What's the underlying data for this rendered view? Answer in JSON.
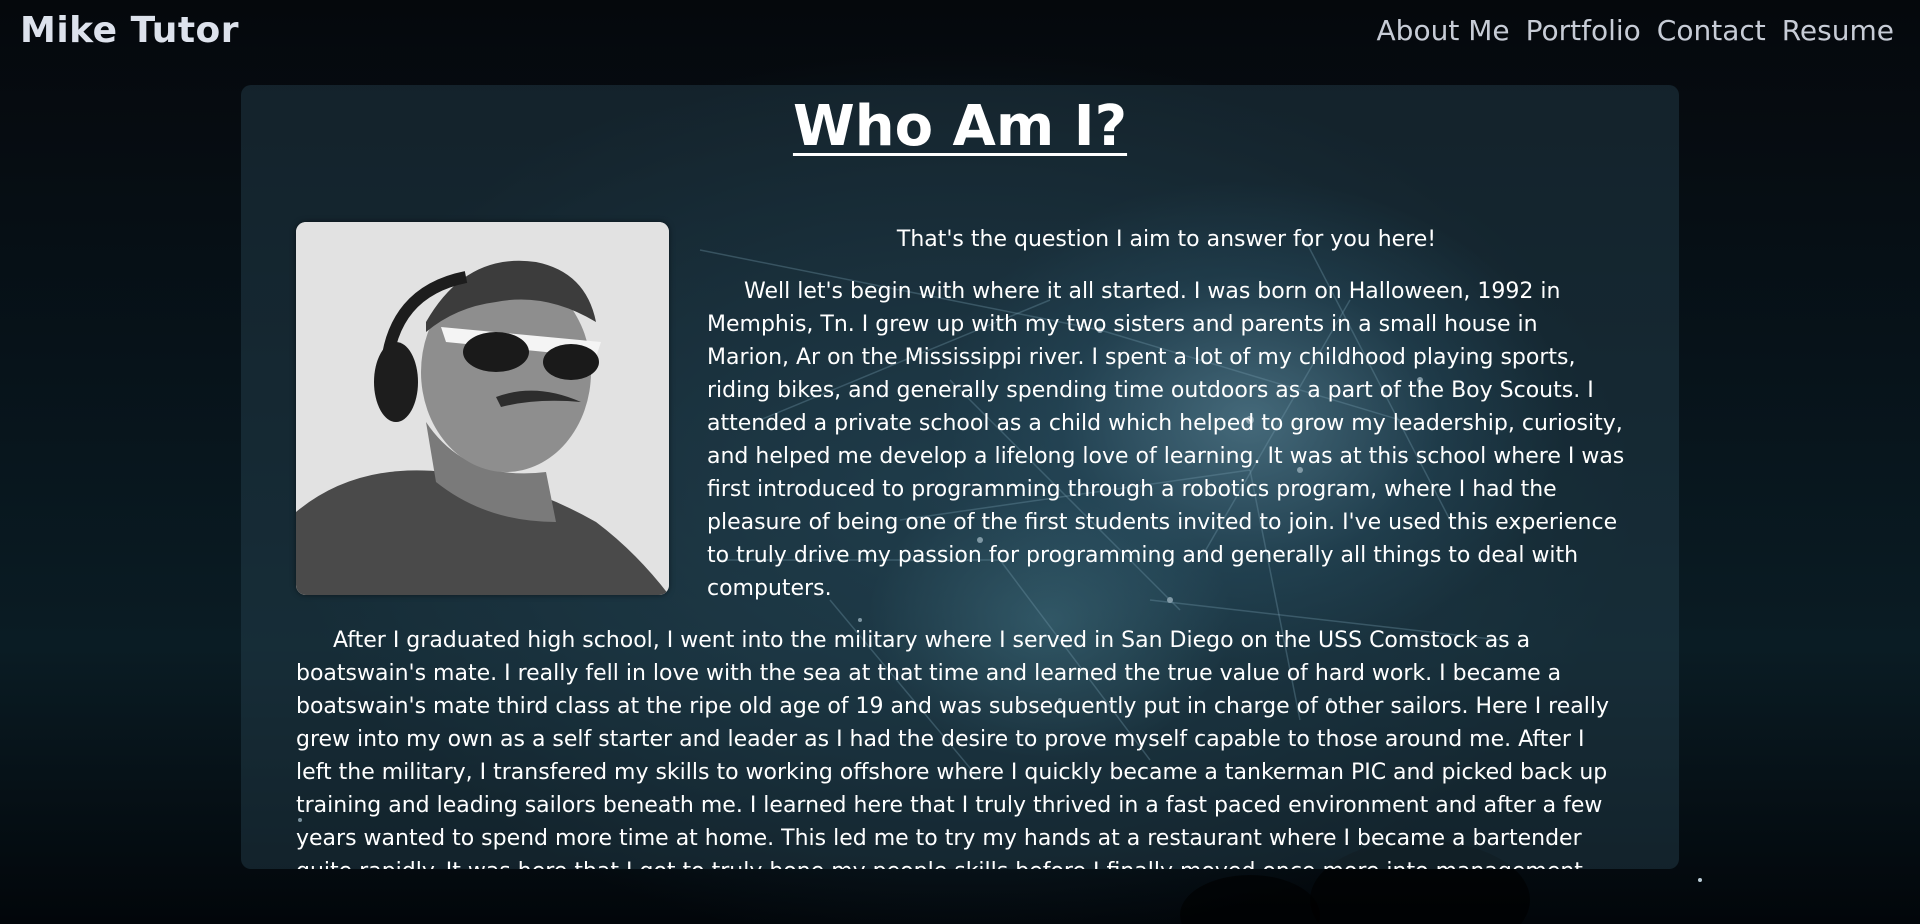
{
  "navbar": {
    "brand": "Mike Tutor",
    "links": [
      "About Me",
      "Portfolio",
      "Contact",
      "Resume"
    ]
  },
  "about": {
    "title": "Who Am I?",
    "intro": "That's the question I aim to answer for you here!",
    "paragraphs": [
      "Well let's begin with where it all started. I was born on Halloween, 1992 in Memphis, Tn. I grew up with my two sisters and parents in a small house in Marion, Ar on the Mississippi river. I spent a lot of my childhood playing sports, riding bikes, and generally spending time outdoors as a part of the Boy Scouts. I attended a private school as a child which helped to grow my leadership, curiosity, and helped me develop a lifelong love of learning. It was at this school where I was first introduced to programming through a robotics program, where I had the pleasure of being one of the first students invited to join. I've used this experience to truly drive my passion for programming and generally all things to deal with computers.",
      "After I graduated high school, I went into the military where I served in San Diego on the USS Comstock as a boatswain's mate. I really fell in love with the sea at that time and learned the true value of hard work. I became a boatswain's mate third class at the ripe old age of 19 and was subsequently put in charge of other sailors. Here I really grew into my own as a self starter and leader as I had the desire to prove myself capable to those around me. After I left the military, I transfered my skills to working offshore where I quickly became a tankerman PIC and picked back up training and leading sailors beneath me. I learned here that I truly thrived in a fast paced environment and after a few years wanted to spend more time at home. This led me to try my hands at a restaurant where I became a bartender quite rapidly. It was here that I got to truly hone my people skills before I finally moved once more into management."
    ]
  }
}
